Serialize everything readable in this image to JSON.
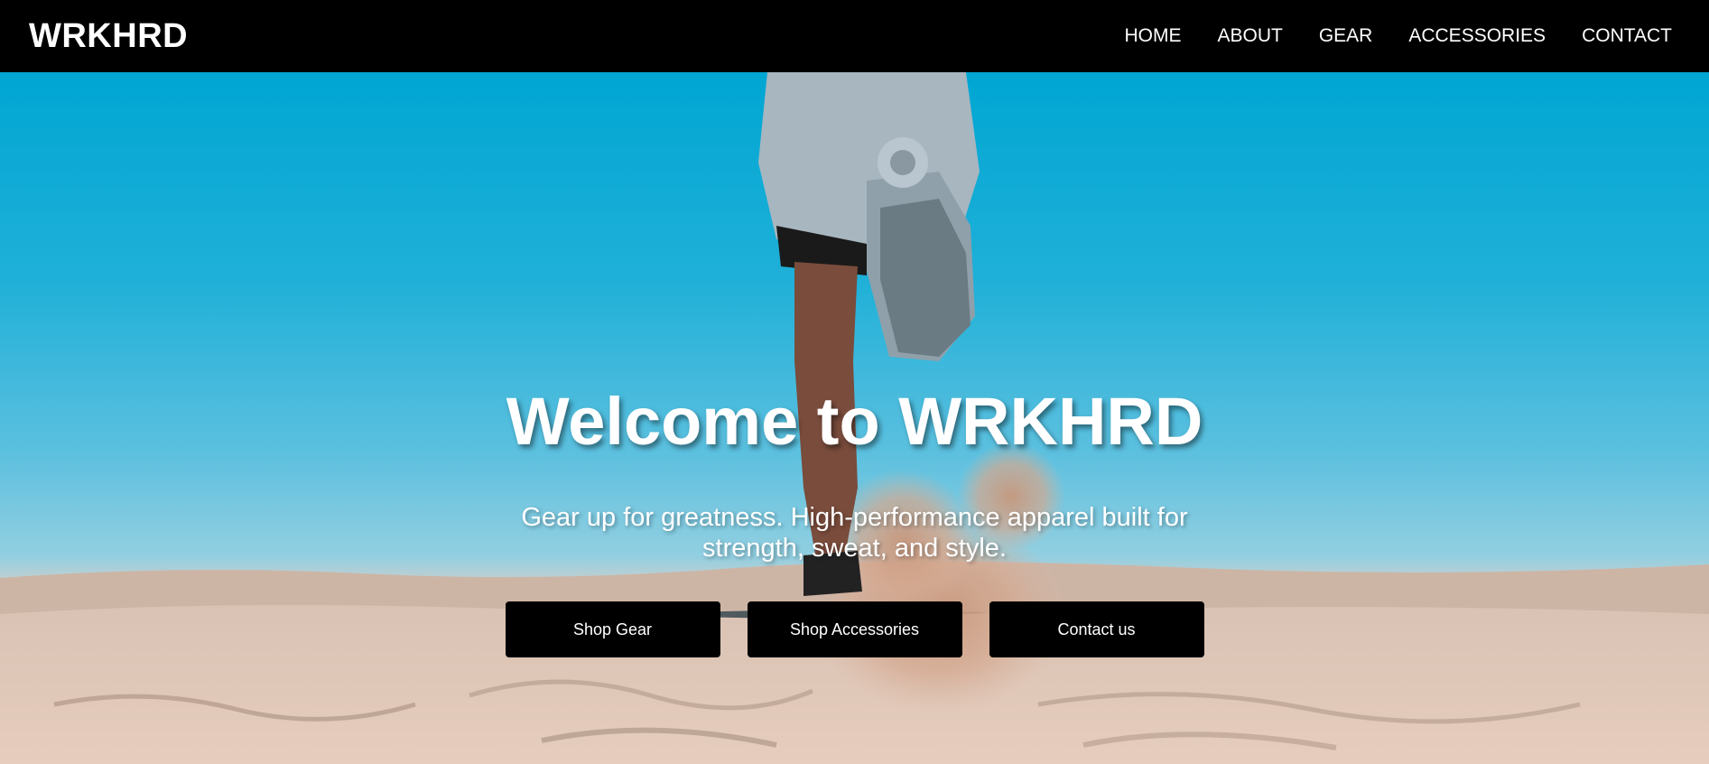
{
  "brand": {
    "name": "WRKHRD"
  },
  "nav": {
    "items": [
      {
        "label": "HOME"
      },
      {
        "label": "ABOUT"
      },
      {
        "label": "GEAR"
      },
      {
        "label": "ACCESSORIES"
      },
      {
        "label": "CONTACT"
      }
    ]
  },
  "hero": {
    "title": "Welcome to WRKHRD",
    "subtitle": "Gear up for greatness. High-performance apparel built for strength, sweat, and style.",
    "buttons": [
      {
        "label": "Shop Gear"
      },
      {
        "label": "Shop Accessories"
      },
      {
        "label": "Contact us"
      }
    ],
    "background_image": "runner-in-desert-photo"
  },
  "colors": {
    "navbar_bg": "#000000",
    "sky": "#00a6d3",
    "sand": "#e3c8b8",
    "button_bg": "#000000",
    "text": "#ffffff"
  }
}
